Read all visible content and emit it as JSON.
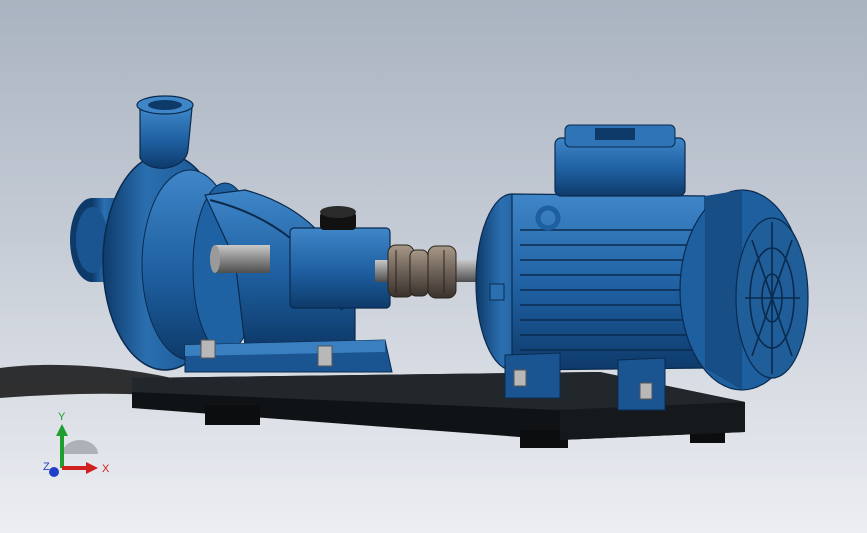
{
  "viewport": {
    "background_top": "#a9b3c0",
    "background_bottom": "#eceef2"
  },
  "model": {
    "body_color": "#1e5fa0",
    "body_dark": "#0e3a6a",
    "body_light": "#3f86c8",
    "base_color": "#101316",
    "shaft_color": "#8a8a8a",
    "coupling_color": "#6d6158"
  },
  "triad": {
    "x_label": "X",
    "y_label": "Y",
    "z_label": "Z",
    "x_color": "#d12020",
    "y_color": "#1e9e2e",
    "z_color": "#2040c8"
  }
}
